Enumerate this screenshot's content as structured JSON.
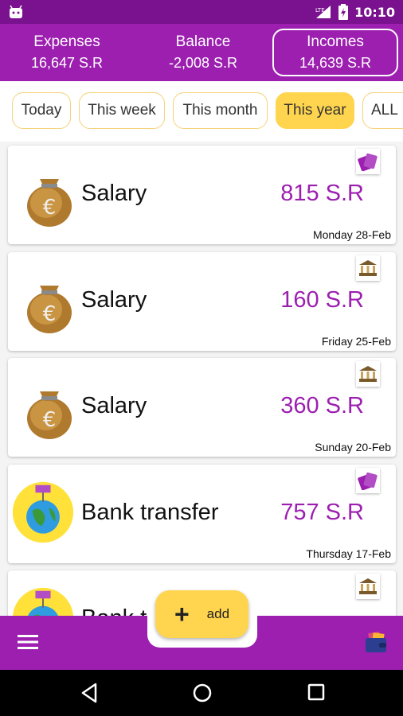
{
  "status_bar": {
    "time": "10:10",
    "network": "LTE"
  },
  "summary": {
    "expenses": {
      "label": "Expenses",
      "value": "16,647 S.R"
    },
    "balance": {
      "label": "Balance",
      "value": "-2,008 S.R"
    },
    "incomes": {
      "label": "Incomes",
      "value": "14,639 S.R"
    }
  },
  "filters": [
    {
      "label": "Today",
      "selected": false
    },
    {
      "label": "This week",
      "selected": false
    },
    {
      "label": "This month",
      "selected": false
    },
    {
      "label": "This year",
      "selected": true
    },
    {
      "label": "ALL",
      "selected": false
    }
  ],
  "transactions": [
    {
      "category": "Salary",
      "amount": "815 S.R",
      "date": "Monday 28-Feb",
      "icon": "money-bag-icon",
      "payment": "cards-icon"
    },
    {
      "category": "Salary",
      "amount": "160 S.R",
      "date": "Friday 25-Feb",
      "icon": "money-bag-icon",
      "payment": "bank-icon"
    },
    {
      "category": "Salary",
      "amount": "360 S.R",
      "date": "Sunday 20-Feb",
      "icon": "money-bag-icon",
      "payment": "bank-icon"
    },
    {
      "category": "Bank transfer",
      "amount": "757 S.R",
      "date": "Thursday 17-Feb",
      "icon": "globe-icon",
      "payment": "cards-icon"
    },
    {
      "category": "Bank transfer",
      "amount": "",
      "date": "",
      "icon": "globe-icon",
      "payment": "bank-icon"
    }
  ],
  "fab": {
    "label": "add"
  },
  "colors": {
    "primary": "#9c1fb0",
    "status_bar": "#7a1290",
    "accent": "#ffd54f",
    "amount": "#9c1fb0"
  }
}
